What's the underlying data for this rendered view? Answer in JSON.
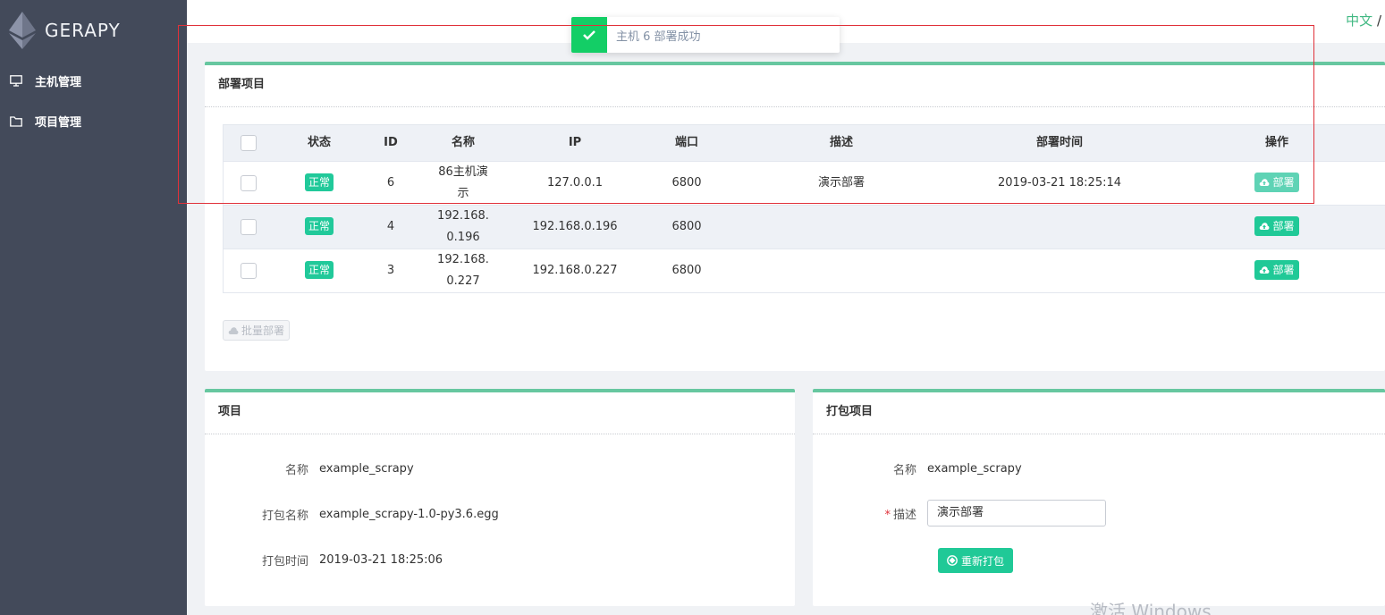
{
  "app": {
    "logo_text": "GERAPY"
  },
  "sidebar": {
    "items": [
      {
        "label": "主机管理",
        "icon": "monitor-icon"
      },
      {
        "label": "项目管理",
        "icon": "folder-icon"
      }
    ]
  },
  "header": {
    "lang_zh": "中文",
    "lang_sep": " /"
  },
  "toast": {
    "message": "主机 6 部署成功",
    "icon": "check-icon"
  },
  "deploy_panel": {
    "title": "部署项目",
    "columns": [
      "状态",
      "ID",
      "名称",
      "IP",
      "端口",
      "描述",
      "部署时间",
      "操作"
    ],
    "rows": [
      {
        "status": "正常",
        "id": "6",
        "name": "86主机演示",
        "ip": "127.0.0.1",
        "port": "6800",
        "desc": "演示部署",
        "time": "2019-03-21 18:25:14",
        "action": "部署"
      },
      {
        "status": "正常",
        "id": "4",
        "name": "192.168.0.196",
        "ip": "192.168.0.196",
        "port": "6800",
        "desc": "",
        "time": "",
        "action": "部署"
      },
      {
        "status": "正常",
        "id": "3",
        "name": "192.168.0.227",
        "ip": "192.168.0.227",
        "port": "6800",
        "desc": "",
        "time": "",
        "action": "部署"
      }
    ],
    "batch_label": "批量部署"
  },
  "project_panel": {
    "title": "项目",
    "name_label": "名称",
    "name_value": "example_scrapy",
    "pkg_label": "打包名称",
    "pkg_value": "example_scrapy-1.0-py3.6.egg",
    "time_label": "打包时间",
    "time_value": "2019-03-21 18:25:06"
  },
  "package_panel": {
    "title": "打包项目",
    "name_label": "名称",
    "name_value": "example_scrapy",
    "desc_label": "描述",
    "desc_value": "演示部署",
    "repack_label": "重新打包"
  },
  "watermark": "激活 Windows",
  "colors": {
    "accent": "#20c997",
    "sidebar": "#434a5a",
    "highlight": "#e0313a",
    "toast_success": "#13ce66"
  }
}
